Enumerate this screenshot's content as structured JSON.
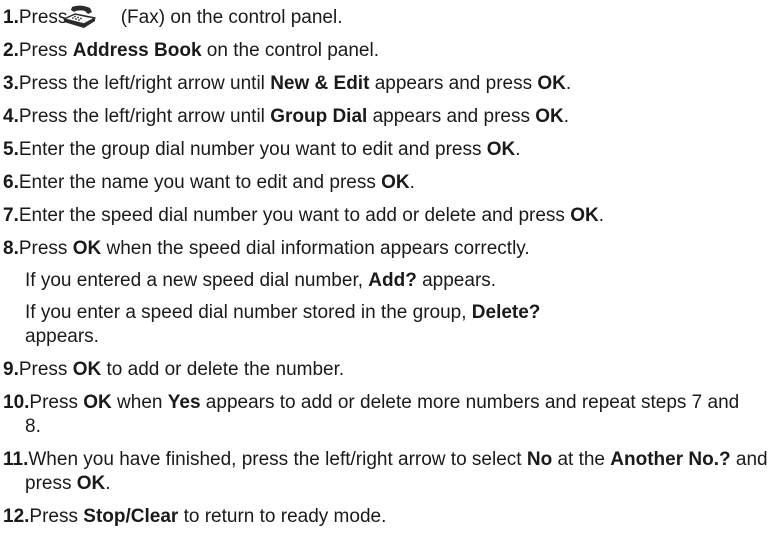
{
  "steps": [
    {
      "num": "1.",
      "pre": "Press ",
      "icon": "fax-icon",
      "post": "(Fax) on the control panel."
    },
    {
      "num": "2.",
      "pre": "Press ",
      "b1": "Address Book",
      "post": " on the control panel."
    },
    {
      "num": "3.",
      "pre": "Press the left/right arrow until ",
      "b1": "New & Edit",
      "mid": " appears and press ",
      "b2": "OK",
      "post": "."
    },
    {
      "num": "4.",
      "pre": "Press the left/right arrow until ",
      "b1": "Group Dial",
      "mid": " appears and press ",
      "b2": "OK",
      "post": "."
    },
    {
      "num": "5.",
      "pre": "Enter the group dial number you want to edit and press ",
      "b1": "OK",
      "post": "."
    },
    {
      "num": "6.",
      "pre": "Enter the name you want to edit and press ",
      "b1": "OK",
      "post": "."
    },
    {
      "num": "7.",
      "pre": "Enter the speed dial number you want to add or delete and press ",
      "b1": "OK",
      "post": "."
    },
    {
      "num": "8.",
      "pre": "Press ",
      "b1": "OK",
      "post": " when the speed dial information appears correctly."
    },
    {
      "num": "9.",
      "pre": "Press ",
      "b1": "OK",
      "post": " to add or delete the number."
    },
    {
      "num": "10.",
      "pre": "Press ",
      "b1": "OK",
      "mid": " when ",
      "b2": "Yes",
      "post": " appears to add or delete more numbers and repeat steps 7 and 8."
    },
    {
      "num": "11.",
      "pre": "When you have finished, press the left/right arrow to select ",
      "b1": "No",
      "mid": " at the ",
      "b2": "Another No.?",
      "mid2": " and press ",
      "b3": "OK",
      "post": "."
    },
    {
      "num": "12.",
      "pre": "Press ",
      "b1": "Stop/Clear",
      "post": " to return to ready mode."
    }
  ],
  "notes": {
    "n1": {
      "pre": "If you entered a new speed dial number, ",
      "b": "Add?",
      "post": " appears."
    },
    "n2": {
      "pre": "If you enter a speed dial number stored in the group, ",
      "b": "Delete?",
      "post": " appears."
    }
  }
}
